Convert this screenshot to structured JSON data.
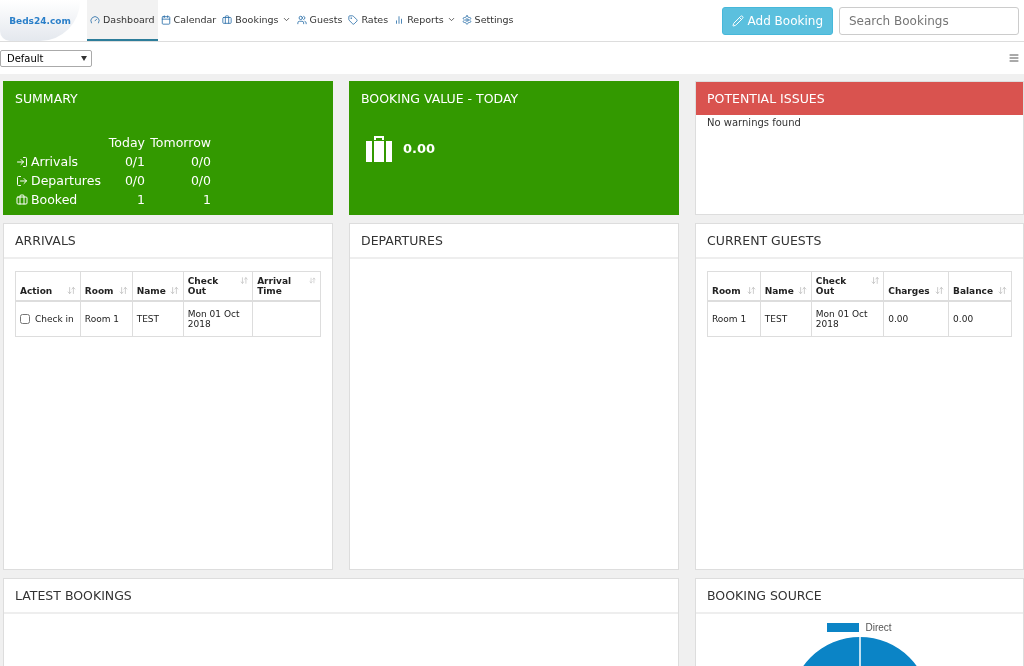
{
  "logo": {
    "text": "Beds24.com"
  },
  "nav": [
    {
      "label": "Dashboard",
      "kind": "dashboard",
      "selected": true,
      "dropdown": false
    },
    {
      "label": "Calendar",
      "kind": "calendar",
      "selected": false,
      "dropdown": false
    },
    {
      "label": "Bookings",
      "kind": "bookings",
      "selected": false,
      "dropdown": true
    },
    {
      "label": "Guests",
      "kind": "guests",
      "selected": false,
      "dropdown": false
    },
    {
      "label": "Rates",
      "kind": "rates",
      "selected": false,
      "dropdown": false
    },
    {
      "label": "Reports",
      "kind": "reports",
      "selected": false,
      "dropdown": true
    },
    {
      "label": "Settings",
      "kind": "settings",
      "selected": false,
      "dropdown": false
    }
  ],
  "add_button": "Add Booking",
  "search": {
    "placeholder": "Search Bookings"
  },
  "layout_select": {
    "value": "Default"
  },
  "summary": {
    "title": "SUMMARY",
    "columns": [
      "Today",
      "Tomorrow"
    ],
    "rows": [
      {
        "label": "Arrivals",
        "kind": "arrivals",
        "today": "0/1",
        "tomorrow": "0/0"
      },
      {
        "label": "Departures",
        "kind": "departures",
        "today": "0/0",
        "tomorrow": "0/0"
      },
      {
        "label": "Booked",
        "kind": "booked",
        "today": "1",
        "tomorrow": "1"
      }
    ]
  },
  "booking_value": {
    "title": "BOOKING VALUE - TODAY",
    "value": "0.00"
  },
  "potential_issues": {
    "title": "POTENTIAL ISSUES",
    "message": "No warnings found"
  },
  "arrivals": {
    "title": "ARRIVALS",
    "columns": [
      "Action",
      "Room",
      "Name",
      "Check Out",
      "Arrival Time"
    ],
    "rows": [
      {
        "checked": false,
        "action": "Check in",
        "room": "Room 1",
        "name": "TEST",
        "check_out": "Mon 01 Oct 2018",
        "arrival_time": ""
      }
    ]
  },
  "departures": {
    "title": "DEPARTURES"
  },
  "current_guests": {
    "title": "CURRENT GUESTS",
    "columns": [
      "Room",
      "Name",
      "Check Out",
      "Charges",
      "Balance"
    ],
    "rows": [
      {
        "cells": [
          "Room 1",
          "TEST",
          "Mon 01 Oct 2018",
          "0.00",
          "0.00"
        ]
      }
    ]
  },
  "latest_bookings": {
    "title": "LATEST BOOKINGS"
  },
  "booking_source": {
    "title": "BOOKING SOURCE",
    "legend": [
      {
        "label": "Direct",
        "color": "#0b84c6"
      }
    ]
  }
}
